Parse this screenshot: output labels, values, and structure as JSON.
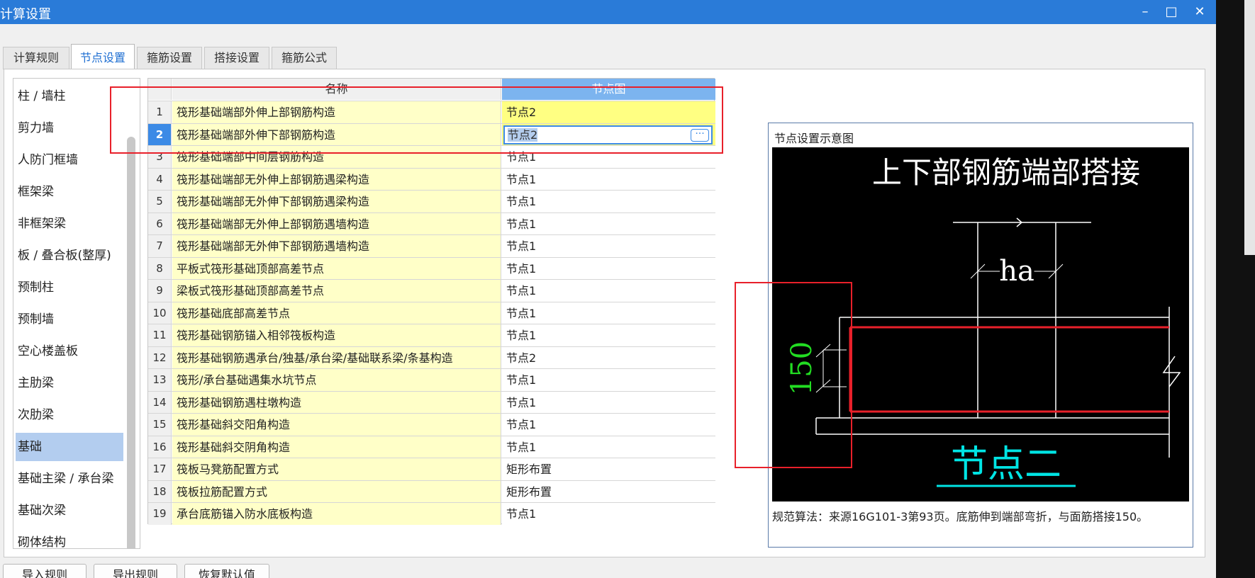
{
  "window": {
    "title": "计算设置"
  },
  "tabs": [
    {
      "label": "计算规则",
      "active": false
    },
    {
      "label": "节点设置",
      "active": true
    },
    {
      "label": "箍筋设置",
      "active": false
    },
    {
      "label": "搭接设置",
      "active": false
    },
    {
      "label": "箍筋公式",
      "active": false
    }
  ],
  "categories": [
    "柱 / 墙柱",
    "剪力墙",
    "人防门框墙",
    "框架梁",
    "非框架梁",
    "板 / 叠合板(整厚)",
    "预制柱",
    "预制墙",
    "空心楼盖板",
    "主肋梁",
    "次肋梁",
    "基础",
    "基础主梁 / 承台梁",
    "基础次梁",
    "砌体结构"
  ],
  "selected_category": "基础",
  "grid": {
    "col_name": "名称",
    "col_node": "节点图",
    "rows": [
      {
        "num": "1",
        "name": "筏形基础端部外伸上部钢筋构造",
        "node": "节点2"
      },
      {
        "num": "2",
        "name": "筏形基础端部外伸下部钢筋构造",
        "node": "节点2"
      },
      {
        "num": "3",
        "name": "筏形基础端部中间层钢筋构造",
        "node": "节点1"
      },
      {
        "num": "4",
        "name": "筏形基础端部无外伸上部钢筋遇梁构造",
        "node": "节点1"
      },
      {
        "num": "5",
        "name": "筏形基础端部无外伸下部钢筋遇梁构造",
        "node": "节点1"
      },
      {
        "num": "6",
        "name": "筏形基础端部无外伸上部钢筋遇墙构造",
        "node": "节点1"
      },
      {
        "num": "7",
        "name": "筏形基础端部无外伸下部钢筋遇墙构造",
        "node": "节点1"
      },
      {
        "num": "8",
        "name": "平板式筏形基础顶部高差节点",
        "node": "节点1"
      },
      {
        "num": "9",
        "name": "梁板式筏形基础顶部高差节点",
        "node": "节点1"
      },
      {
        "num": "10",
        "name": "筏形基础底部高差节点",
        "node": "节点1"
      },
      {
        "num": "11",
        "name": "筏形基础钢筋锚入相邻筏板构造",
        "node": "节点1"
      },
      {
        "num": "12",
        "name": "筏形基础钢筋遇承台/独基/承台梁/基础联系梁/条基构造",
        "node": "节点2"
      },
      {
        "num": "13",
        "name": "筏形/承台基础遇集水坑节点",
        "node": "节点1"
      },
      {
        "num": "14",
        "name": "筏形基础钢筋遇柱墩构造",
        "node": "节点1"
      },
      {
        "num": "15",
        "name": "筏形基础斜交阳角构造",
        "node": "节点1"
      },
      {
        "num": "16",
        "name": "筏形基础斜交阴角构造",
        "node": "节点1"
      },
      {
        "num": "17",
        "name": "筏板马凳筋配置方式",
        "node": "矩形布置"
      },
      {
        "num": "18",
        "name": "筏板拉筋配置方式",
        "node": "矩形布置"
      },
      {
        "num": "19",
        "name": "承台底筋锚入防水底板构造",
        "node": "节点1"
      }
    ]
  },
  "preview": {
    "title": "节点设置示意图",
    "diagram_heading": "上下部钢筋端部搭接",
    "dim_ha": "ha",
    "dim_150": "150",
    "diagram_caption": "节点二",
    "description": "规范算法：来源16G101-3第93页。底筋伸到端部弯折，与面筋搭接150。"
  },
  "bottom_buttons": [
    "导入规则",
    "导出规则",
    "恢复默认值"
  ],
  "colors": {
    "titlebar": "#2a7bd8",
    "accent": "#3c8ae6",
    "highlight_red": "#e8202a",
    "cyan": "#00e5e5",
    "green": "#22dd22"
  },
  "icons": {
    "minimize": "minimize-icon",
    "maximize": "maximize-icon",
    "close": "close-icon",
    "more": "ellipsis-icon"
  }
}
